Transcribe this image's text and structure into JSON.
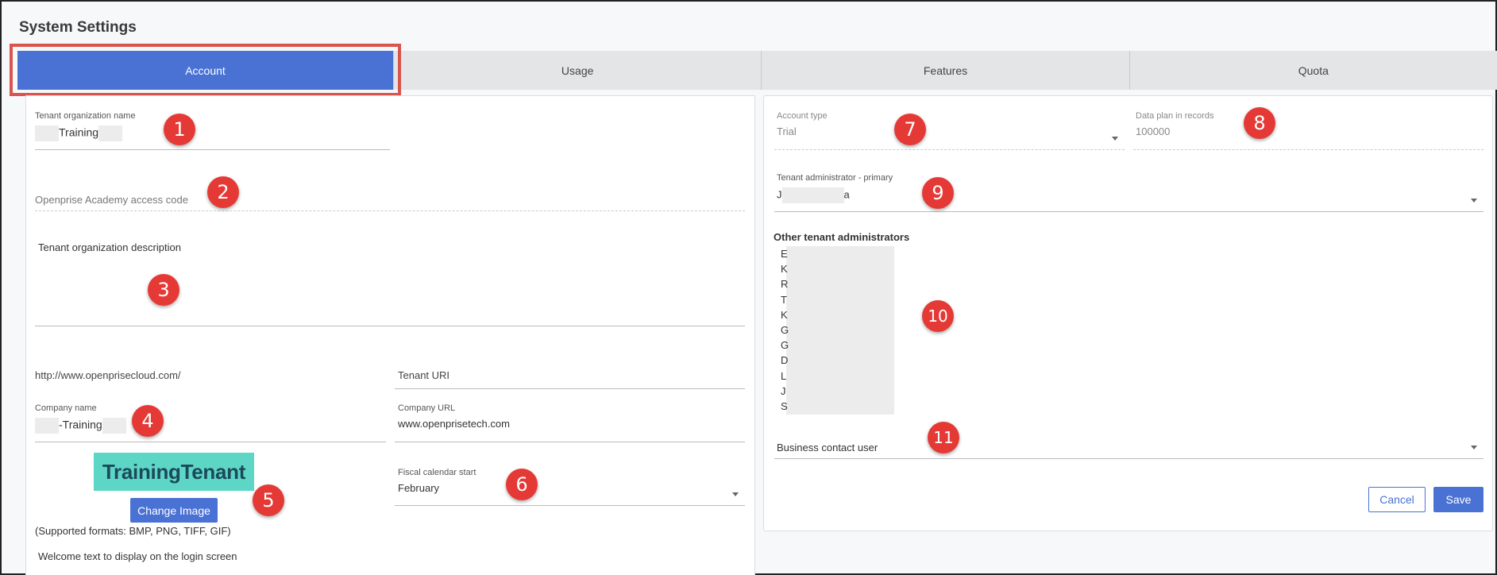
{
  "page": {
    "title": "System Settings"
  },
  "tabs": [
    {
      "label": "Account",
      "active": true
    },
    {
      "label": "Usage",
      "active": false
    },
    {
      "label": "Features",
      "active": false
    },
    {
      "label": "Quota",
      "active": false
    }
  ],
  "left": {
    "tenant_org_name": {
      "label": "Tenant organization name",
      "value": "Training"
    },
    "academy_code": {
      "placeholder": "Openprise Academy access code"
    },
    "org_description": {
      "label": "Tenant organization description"
    },
    "tenant_uri": {
      "prefix": "http://www.openprisecloud.com/",
      "placeholder": "Tenant URI"
    },
    "company_name": {
      "label": "Company name",
      "value": "-Training"
    },
    "company_url": {
      "label": "Company URL",
      "value": "www.openprisetech.com"
    },
    "logo": {
      "text": "TrainingTenant",
      "bg_color": "#5dd6c6"
    },
    "change_image_label": "Change Image",
    "supported_formats": "(Supported formats: BMP, PNG, TIFF, GIF)",
    "fiscal_calendar": {
      "label": "Fiscal calendar start",
      "value": "February"
    },
    "welcome_text_label": "Welcome text to display on the login screen"
  },
  "right": {
    "account_type": {
      "label": "Account type",
      "value": "Trial"
    },
    "data_plan": {
      "label": "Data plan in records",
      "value": "100000"
    },
    "primary_admin": {
      "label": "Tenant administrator - primary",
      "value_start": "J",
      "value_end": "a"
    },
    "other_admins": {
      "label": "Other tenant administrators",
      "initials": [
        "E",
        "K",
        "R",
        "T",
        "K",
        "G",
        "G",
        "D",
        "L",
        "J",
        "S"
      ]
    },
    "business_contact": {
      "placeholder": "Business contact user"
    },
    "cancel_label": "Cancel",
    "save_label": "Save"
  },
  "callouts": [
    "1",
    "2",
    "3",
    "4",
    "5",
    "6",
    "7",
    "8",
    "9",
    "10",
    "11"
  ],
  "colors": {
    "accent": "#4a72d4",
    "callout": "#e53935",
    "highlight": "#d9534f"
  }
}
